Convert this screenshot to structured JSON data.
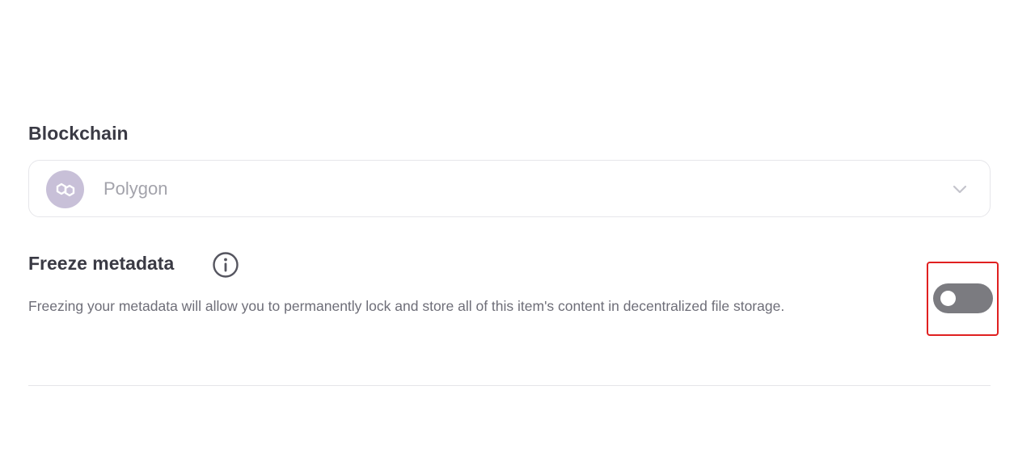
{
  "blockchain": {
    "label": "Blockchain",
    "selected": "Polygon",
    "icon": "polygon-icon",
    "dropdown_icon": "chevron-down-icon"
  },
  "freeze": {
    "title": "Freeze metadata",
    "info_icon": "info-icon",
    "description": "Freezing your metadata will allow you to permanently lock and store all of this item's content in decentralized file storage.",
    "toggle_on": false
  },
  "colors": {
    "highlight": "#e02020",
    "toggle_off": "#7b7b80",
    "icon_bg": "#c8c0d8"
  }
}
